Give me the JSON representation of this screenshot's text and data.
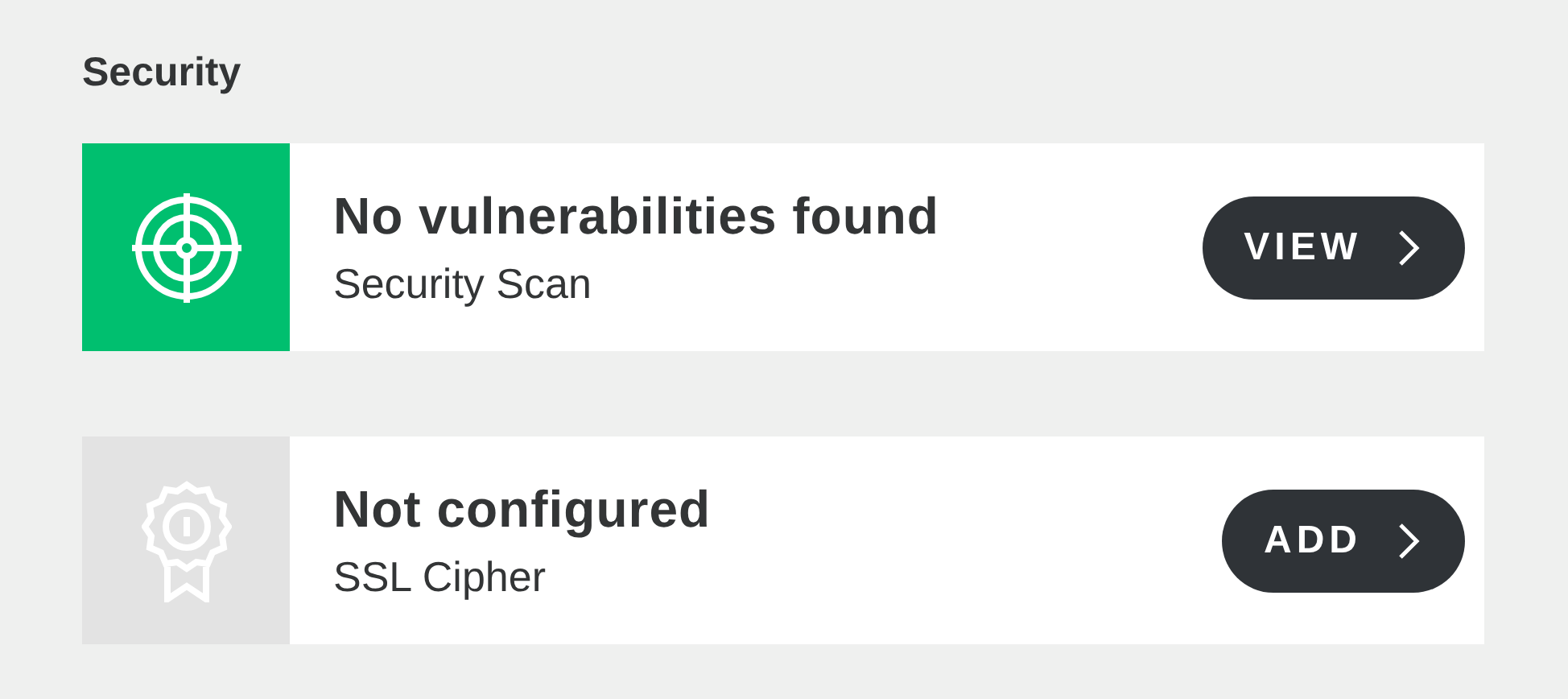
{
  "section": {
    "title": "Security"
  },
  "items": [
    {
      "kind": "scan",
      "passed": true,
      "title": "No vulnerabilities found",
      "subtitle": "Security Scan",
      "action": "VIEW"
    },
    {
      "kind": "certificate",
      "passed": false,
      "title": "Not configured",
      "subtitle": "SSL Cipher",
      "action": "ADD"
    }
  ]
}
